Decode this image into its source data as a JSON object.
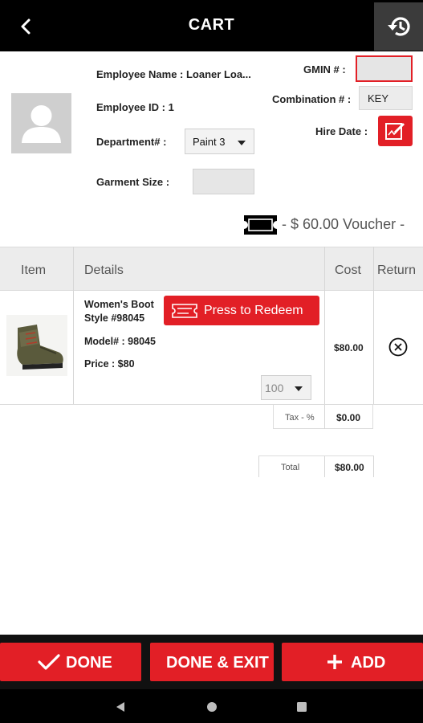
{
  "header": {
    "title": "CART"
  },
  "employee": {
    "name": "Employee Name : Loaner Loa...",
    "id": "Employee ID : 1",
    "department_label": "Department# :",
    "department_value": "Paint 3",
    "garment_size_label": "Garment Size :",
    "gmin_label": "GMIN # :",
    "combination_label": "Combination # :",
    "combination_value": "KEY",
    "hire_date_label": "Hire Date :"
  },
  "voucher": {
    "text": "- $ 60.00 Voucher -"
  },
  "table": {
    "headers": [
      "Item",
      "Details",
      "Cost",
      "Return"
    ],
    "items": [
      {
        "name_line1": "Women's Boot",
        "name_line2": "Style #98045",
        "model": "Model# : 98045",
        "price": "Price : $80",
        "quantity": "100",
        "cost": "$80.00",
        "redeem_label": "Press to Redeem"
      }
    ]
  },
  "summary": {
    "tax_label": "Tax - %",
    "tax_value": "$0.00",
    "total_label": "Total",
    "total_value": "$80.00"
  },
  "buttons": {
    "done": "DONE",
    "done_exit": "DONE & EXIT",
    "add": "ADD"
  },
  "colors": {
    "accent": "#e21f26",
    "topbar": "#000000"
  }
}
